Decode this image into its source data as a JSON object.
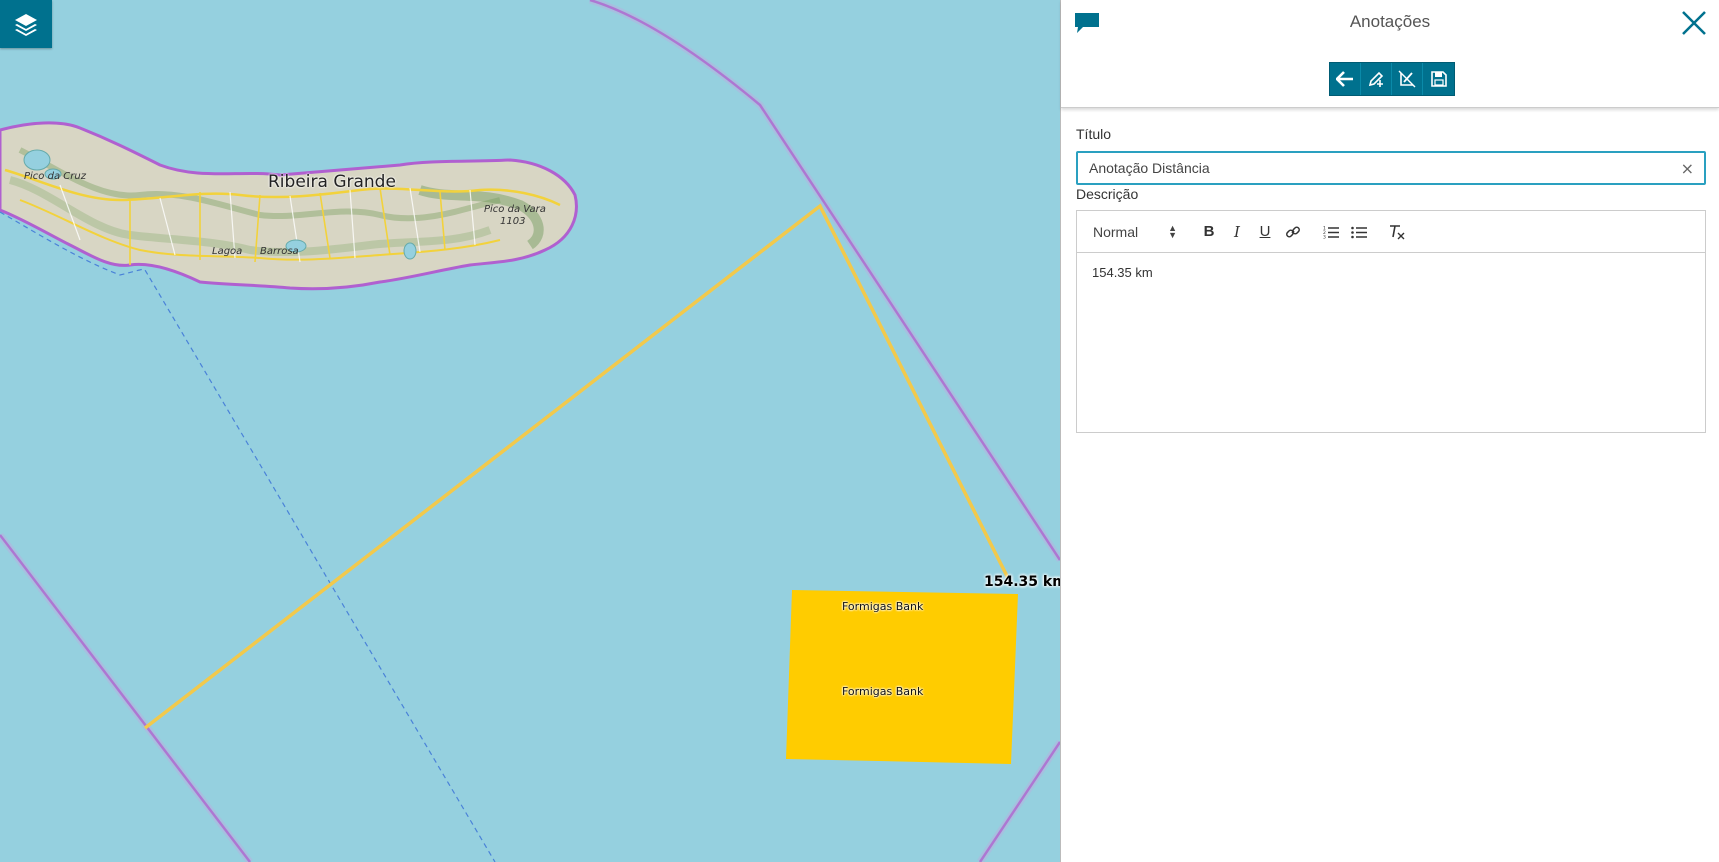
{
  "map": {
    "layers_icon": "layers-icon",
    "place_labels": {
      "ribeira_grande": "Ribeira Grande",
      "pico_da_cruz": "Pico da Cruz",
      "pico_da_vara": "Pico da Vara",
      "altitude": "1103",
      "lagoa": "Lagoa",
      "barrosa": "Barrosa"
    },
    "bank_labels": [
      "Formigas Bank",
      "Formigas Bank"
    ],
    "measurement_label": "154.35 km",
    "colors": {
      "sea": "#95d0df",
      "measure_line": "#f2c94c",
      "bank_area": "#ffcc00",
      "boundary": "#a04dc8"
    }
  },
  "panel": {
    "header_icon": "comment-icon",
    "title": "Anotações",
    "close_icon": "close-icon",
    "toolbar": {
      "back_icon": "arrow-left-icon",
      "draw_icon": "pencil-add-icon",
      "edit_geometry_icon": "edit-geometry-icon",
      "save_icon": "save-icon"
    },
    "titulo_label": "Título",
    "titulo_value": "Anotação Distância",
    "descricao_label": "Descrição",
    "editor": {
      "format_value": "Normal",
      "bold": "B",
      "italic": "I",
      "underline": "U",
      "content": "154.35 km"
    },
    "accent_color": "#00718e"
  }
}
